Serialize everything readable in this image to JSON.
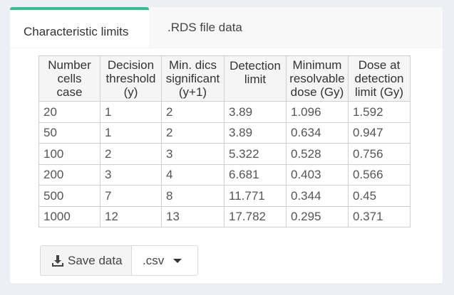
{
  "tabs": [
    {
      "label": "Characteristic limits",
      "active": true
    },
    {
      "label": ".RDS file data",
      "active": false
    }
  ],
  "table": {
    "headers": [
      [
        "Number",
        "cells",
        "case"
      ],
      [
        "Decision",
        "threshold",
        "(y)"
      ],
      [
        "Min. dics",
        "significant",
        "(y+1)"
      ],
      [
        "Detection",
        "limit",
        ""
      ],
      [
        "Minimum",
        "resolvable",
        "dose (Gy)"
      ],
      [
        "Dose at",
        "detection",
        "limit (Gy)"
      ]
    ],
    "rows": [
      [
        "20",
        "1",
        "2",
        "3.89",
        "1.096",
        "1.592"
      ],
      [
        "50",
        "1",
        "2",
        "3.89",
        "0.634",
        "0.947"
      ],
      [
        "100",
        "2",
        "3",
        "5.322",
        "0.528",
        "0.756"
      ],
      [
        "200",
        "3",
        "4",
        "6.681",
        "0.403",
        "0.566"
      ],
      [
        "500",
        "7",
        "8",
        "11.771",
        "0.344",
        "0.45"
      ],
      [
        "1000",
        "12",
        "13",
        "17.782",
        "0.295",
        "0.371"
      ]
    ]
  },
  "actions": {
    "save_label": "Save data",
    "save_icon": "download-icon",
    "format_label": ".csv",
    "format_icon": "caret-down-icon"
  },
  "colors": {
    "accent": "#2fc08d",
    "background": "#ecf0f5"
  }
}
